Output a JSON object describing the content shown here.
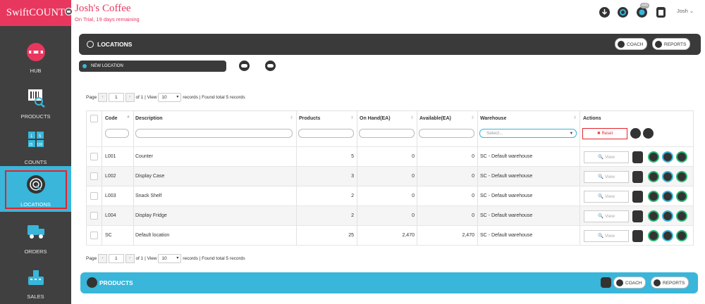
{
  "brand": "SwiftCOUNT",
  "header": {
    "title": "Josh's Coffee",
    "subtitle": "On Trial, 19 days remaining",
    "notification_count": "445",
    "user": "Josh ⌄"
  },
  "sidebar": {
    "items": [
      {
        "label": "HUB",
        "icon": "hub-icon"
      },
      {
        "label": "PRODUCTS",
        "icon": "barcode-search-icon"
      },
      {
        "label": "COUNTS",
        "icon": "counts-grid-icon"
      },
      {
        "label": "LOCATIONS",
        "icon": "location-pin-icon"
      },
      {
        "label": "ORDERS",
        "icon": "truck-icon"
      },
      {
        "label": "SALES",
        "icon": "cash-register-icon"
      }
    ],
    "active": "LOCATIONS",
    "active_color": "#39b6da"
  },
  "locations_panel": {
    "title": "LOCATIONS",
    "coach": "COACH",
    "reports": "REPORTS",
    "new_location": "NEW LOCATION"
  },
  "pager": {
    "page_label": "Page",
    "prev": "‹",
    "next": "›",
    "page": "1",
    "of_label": "of 1 | View",
    "per_page": "10",
    "records_label": "records | Found total 5 records"
  },
  "table": {
    "headers": {
      "code": "Code",
      "description": "Description",
      "products": "Products",
      "on_hand": "On Hand(EA)",
      "available": "Available(EA)",
      "warehouse": "Warehouse",
      "actions": "Actions"
    },
    "warehouse_placeholder": "Select...",
    "reset": "✖ Reset",
    "view": "🔍 View",
    "rows": [
      {
        "code": "L001",
        "description": "Counter",
        "products": "5",
        "on_hand": "0",
        "available": "0",
        "warehouse": "SC - Default warehouse"
      },
      {
        "code": "L002",
        "description": "Display Case",
        "products": "3",
        "on_hand": "0",
        "available": "0",
        "warehouse": "SC - Default warehouse"
      },
      {
        "code": "L003",
        "description": "Snack Shelf",
        "products": "2",
        "on_hand": "0",
        "available": "0",
        "warehouse": "SC - Default warehouse"
      },
      {
        "code": "L004",
        "description": "Display Fridge",
        "products": "2",
        "on_hand": "0",
        "available": "0",
        "warehouse": "SC - Default warehouse"
      },
      {
        "code": "SC",
        "description": "Default location",
        "products": "25",
        "on_hand": "2,470",
        "available": "2,470",
        "warehouse": "SC - Default warehouse"
      }
    ]
  },
  "products_panel": {
    "title": "PRODUCTS",
    "coach": "COACH",
    "reports": "REPORTS"
  }
}
